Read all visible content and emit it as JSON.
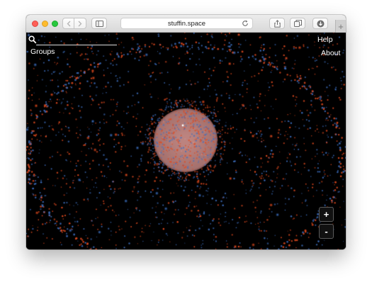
{
  "browser": {
    "address": "stuffin.space",
    "new_tab_label": "+",
    "icons": [
      "back-arrow-icon",
      "forward-arrow-icon",
      "sidebar-icon",
      "reload-icon",
      "share-icon",
      "tabs-icon",
      "download-icon"
    ]
  },
  "app": {
    "groups_label": "Groups",
    "help_label": "Help",
    "about_label": "About",
    "zoom_in_label": "+",
    "zoom_out_label": "-",
    "search_placeholder": ""
  },
  "colors": {
    "background": "#000000",
    "debris": "#e04a1f",
    "satellite": "#3d6fc0",
    "earth_glow": "#c98a86"
  }
}
